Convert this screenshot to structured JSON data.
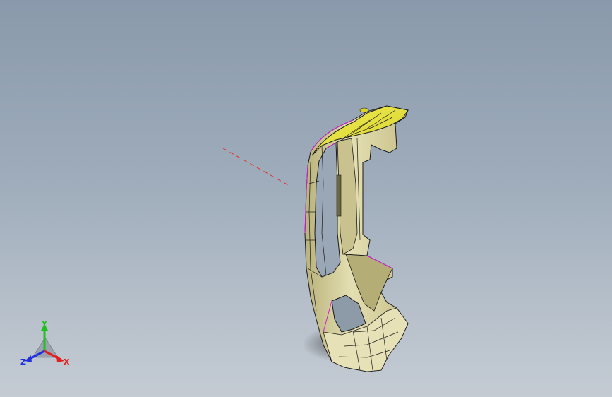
{
  "viewport": {
    "background_top": "#8a99ab",
    "background_bottom": "#c4cbd3"
  },
  "model": {
    "body_color": "#d8d3a2",
    "shade_color": "#a8a06a",
    "highlight_color": "#f5f07a",
    "selected_face_color": "#e8e43a",
    "edge_color": "#1a1a1a",
    "silhouette_color": "#d020d0"
  },
  "sketch_line": {
    "color": "#e83030",
    "style": "dashed"
  },
  "triad": {
    "x_label": "X",
    "y_label": "Y",
    "z_label": "Z",
    "x_color": "#e02020",
    "y_color": "#20c020",
    "z_color": "#2030e0"
  }
}
